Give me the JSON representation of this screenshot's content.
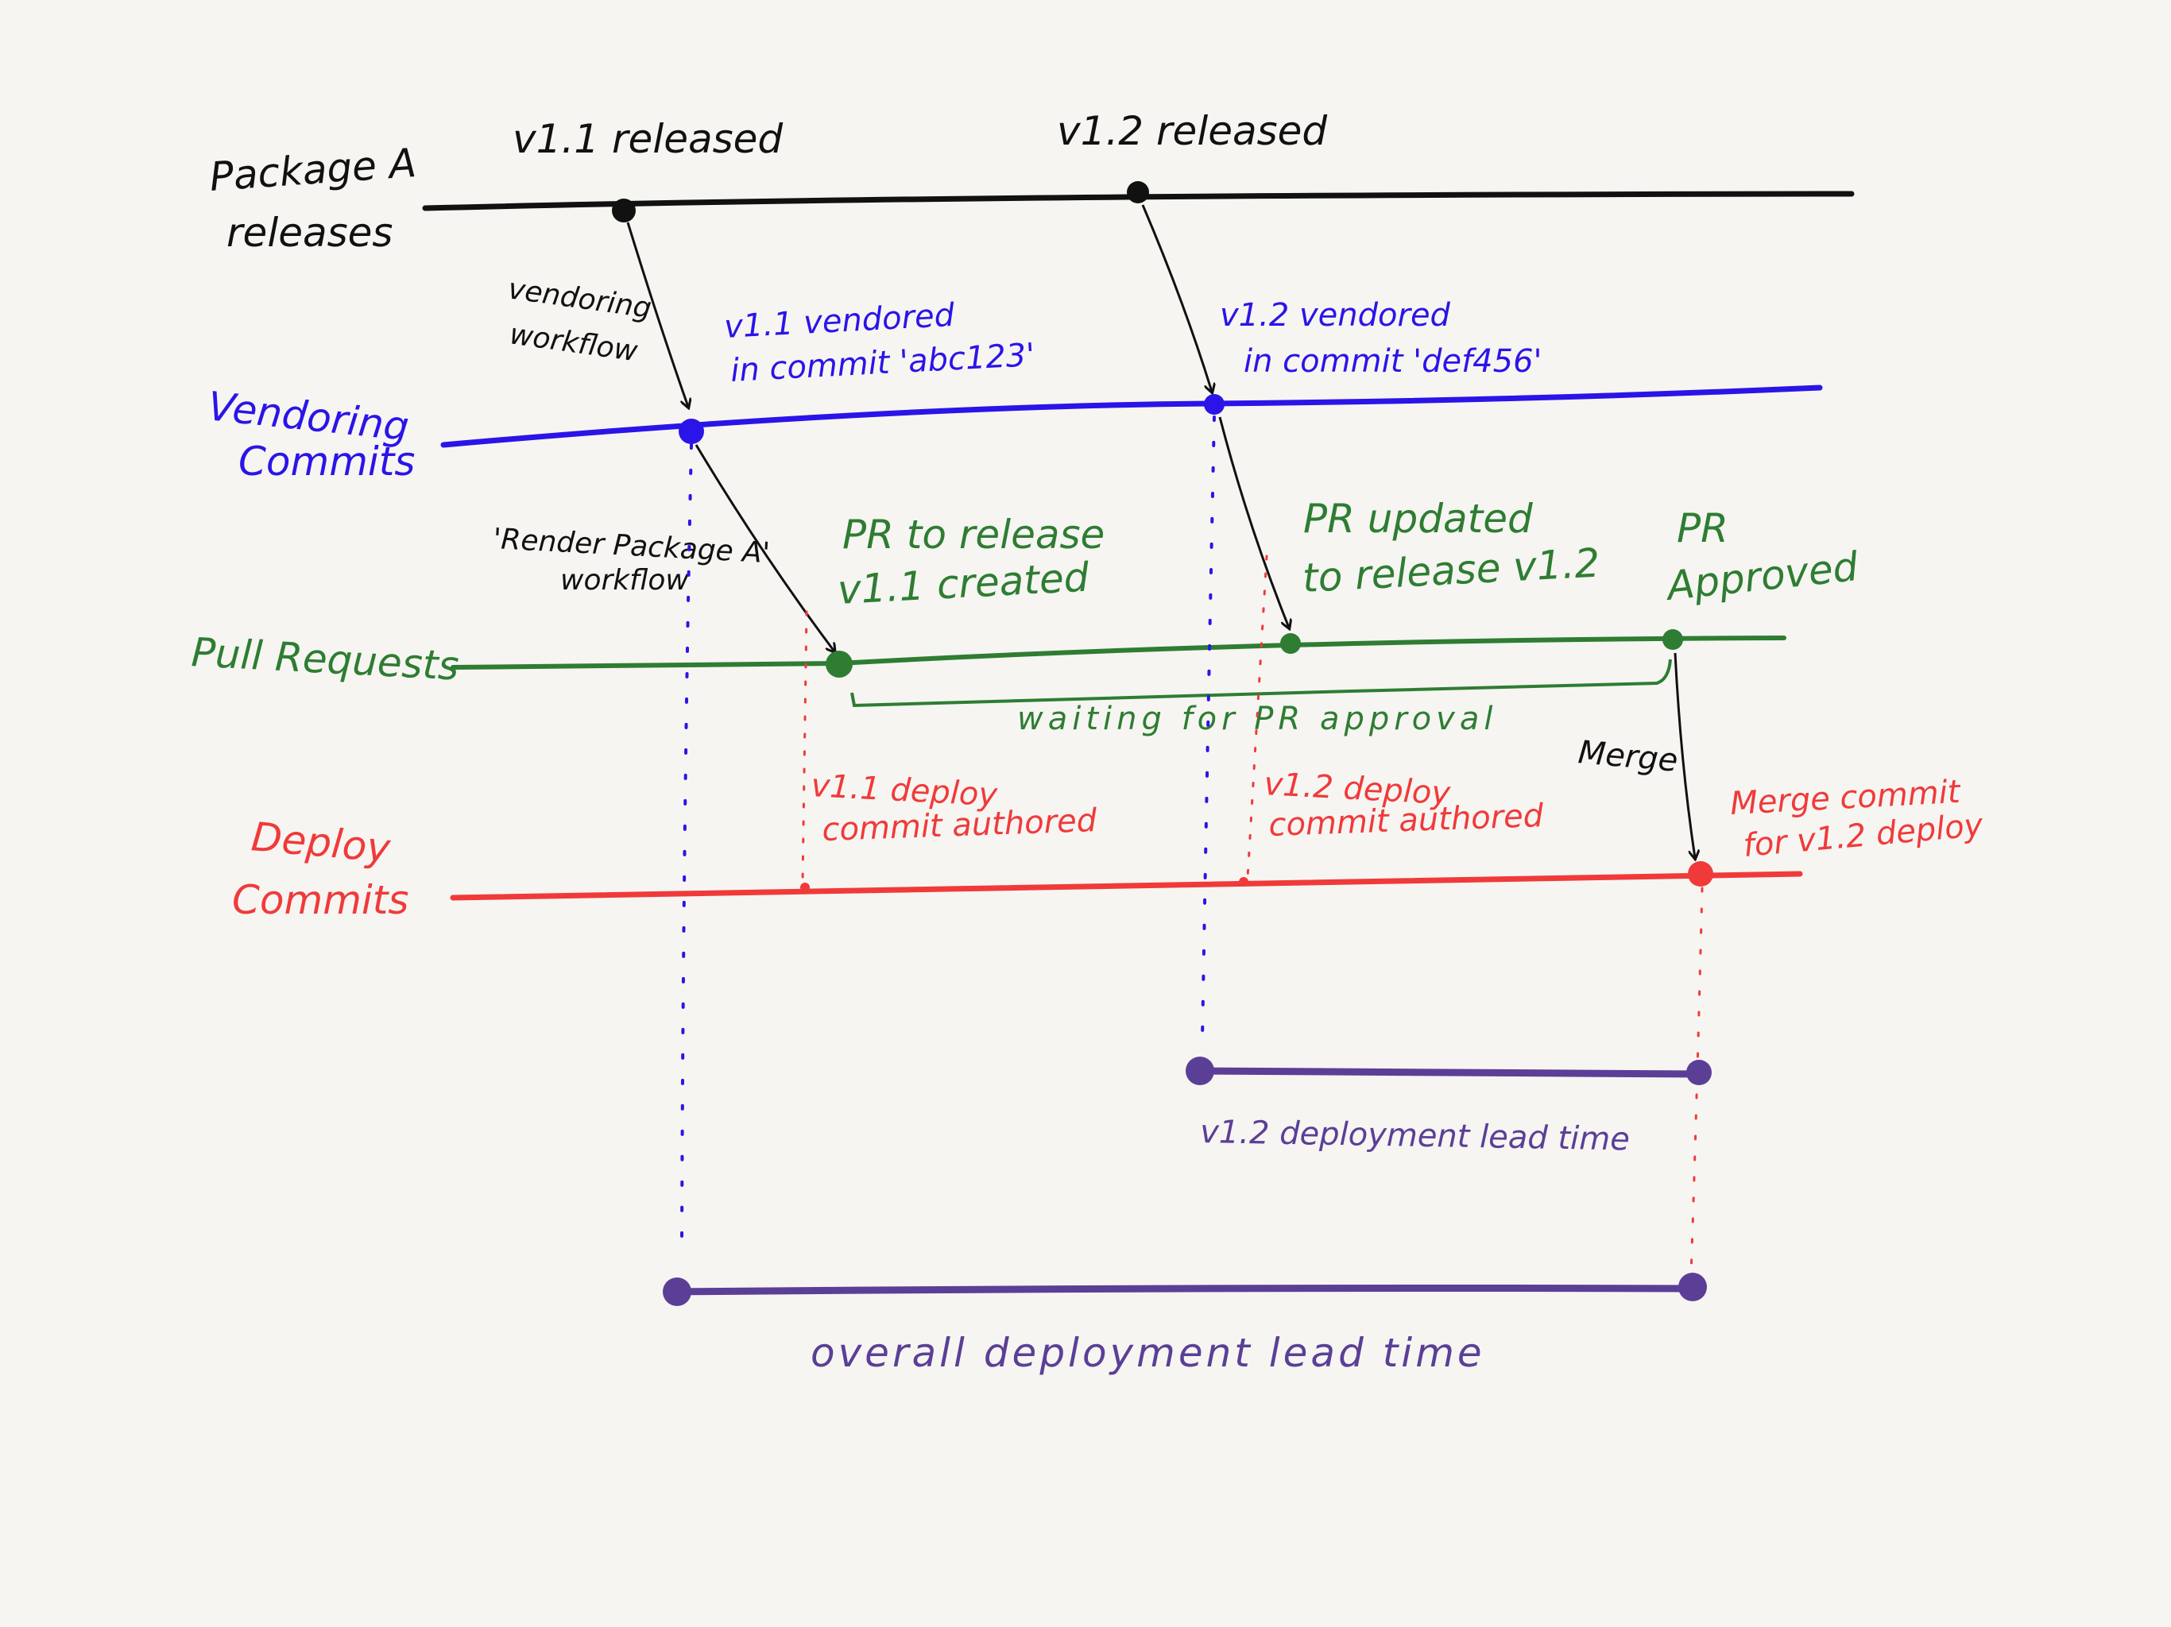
{
  "colors": {
    "background": "#f6f5f2",
    "package": "#111111",
    "vendoring": "#2b14e8",
    "pull_requests": "#2e7d32",
    "deploy": "#f03a3a",
    "lead_time": "#5b3f96"
  },
  "lanes": {
    "package": {
      "label_line1": "Package A",
      "label_line2": "releases"
    },
    "vendoring": {
      "label_line1": "Vendoring",
      "label_line2": "Commits"
    },
    "pull_requests": {
      "label": "Pull Requests"
    },
    "deploy": {
      "label_line1": "Deploy",
      "label_line2": "Commits"
    }
  },
  "events": {
    "v11_released": "v1.1 released",
    "v12_released": "v1.2 released",
    "v11_vendored_line1": "v1.1 vendored",
    "v11_vendored_line2": "in commit 'abc123'",
    "v12_vendored_line1": "v1.2 vendored",
    "v12_vendored_line2": "in commit 'def456'",
    "pr_created_line1": "PR to release",
    "pr_created_line2": "v1.1 created",
    "pr_updated_line1": "PR updated",
    "pr_updated_line2": "to release v1.2",
    "pr_approved_line1": "PR",
    "pr_approved_line2": "Approved",
    "v11_deploy_line1": "v1.1 deploy",
    "v11_deploy_line2": "commit authored",
    "v12_deploy_line1": "v1.2 deploy",
    "v12_deploy_line2": "commit authored",
    "merge_commit_line1": "Merge commit",
    "merge_commit_line2": "for v1.2 deploy"
  },
  "arrows": {
    "vendoring_workflow_line1": "vendoring",
    "vendoring_workflow_line2": "workflow",
    "render_workflow_line1": "'Render Package A'",
    "render_workflow_line2": "workflow",
    "merge": "Merge"
  },
  "annotations": {
    "waiting": "waiting for PR approval",
    "v12_lead_time": "v1.2 deployment lead time",
    "overall_lead_time": "overall deployment lead time"
  }
}
